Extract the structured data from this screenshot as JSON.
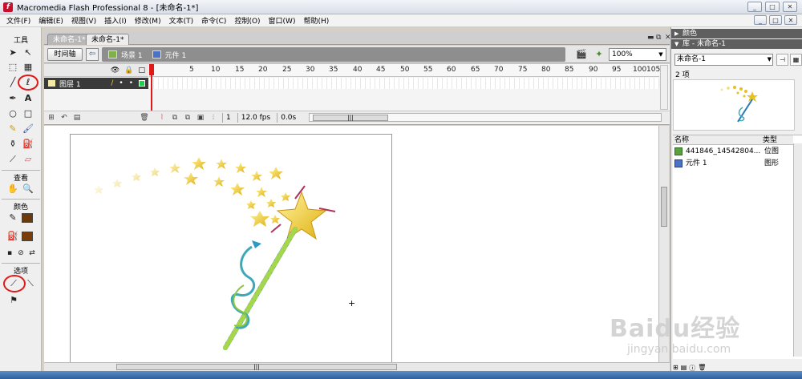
{
  "window": {
    "title": "Macromedia Flash Professional 8 - [未命名-1*]",
    "app_icon_letter": "f",
    "buttons": [
      "_",
      "□",
      "✕"
    ]
  },
  "menubar": {
    "items": [
      "文件(F)",
      "编辑(E)",
      "视图(V)",
      "插入(I)",
      "修改(M)",
      "文本(T)",
      "命令(C)",
      "控制(O)",
      "窗口(W)",
      "帮助(H)"
    ],
    "doc_buttons": [
      "_",
      "□",
      "✕"
    ]
  },
  "tools": {
    "title": "工具",
    "view_title": "查看",
    "color_title": "颜色",
    "options_title": "选项",
    "stroke_color": "#6b3a0c",
    "fill_color": "#7a3e0a"
  },
  "doc_tabs": {
    "tabs": [
      "未命名-1*",
      "未命名-1*"
    ],
    "active_index": 1,
    "controls": [
      "▬",
      "⧉",
      "✕"
    ]
  },
  "edit_bar": {
    "timeline_button": "时间轴",
    "back_icon": "⇦",
    "breadcrumbs": [
      "场景 1",
      "元件 1"
    ],
    "zoom": "100%"
  },
  "timeline": {
    "layer_name": "图层 1",
    "ruler_numbers": [
      "5",
      "10",
      "15",
      "20",
      "25",
      "30",
      "35",
      "40",
      "45",
      "50",
      "55",
      "60",
      "65",
      "70",
      "75",
      "80",
      "85",
      "90",
      "95",
      "100",
      "105"
    ],
    "current_frame": "1",
    "fps": "12.0 fps",
    "time": "0.0s"
  },
  "library": {
    "color_panel_title": "颜色",
    "panel_title": "库 - 未命名-1",
    "document": "未命名-1",
    "item_count": "2 项",
    "col_name": "名称",
    "col_type": "类型",
    "items": [
      {
        "name": "441846_14542804...",
        "type": "位图"
      },
      {
        "name": "元件 1",
        "type": "图形"
      }
    ]
  },
  "watermark": {
    "logo": "Baidu经验",
    "url": "jingyan.baidu.com"
  }
}
